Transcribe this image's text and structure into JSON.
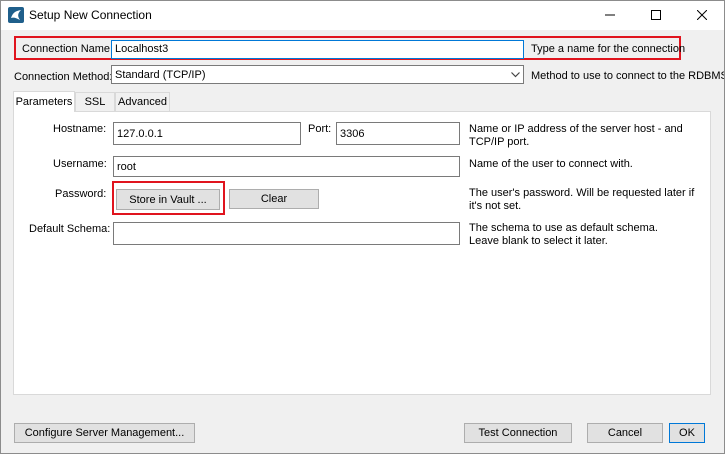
{
  "window": {
    "title": "Setup New Connection",
    "icon": "mysql-workbench-icon",
    "controls": [
      "minimize-icon",
      "maximize-icon",
      "close-icon"
    ]
  },
  "connection_name": {
    "label": "Connection Name:",
    "value": "Localhost3",
    "hint": "Type a name for the connection"
  },
  "connection_method": {
    "label": "Connection Method:",
    "value": "Standard (TCP/IP)",
    "hint": "Method to use to connect to the RDBMS"
  },
  "tabs": [
    {
      "label": "Parameters",
      "active": true
    },
    {
      "label": "SSL",
      "active": false
    },
    {
      "label": "Advanced",
      "active": false
    }
  ],
  "parameters": {
    "hostname": {
      "label": "Hostname:",
      "value": "127.0.0.1"
    },
    "port": {
      "label": "Port:",
      "value": "3306"
    },
    "hostname_hint": "Name or IP address of the server host - and TCP/IP port.",
    "username": {
      "label": "Username:",
      "value": "root",
      "hint": "Name of the user to connect with."
    },
    "password": {
      "label": "Password:",
      "store_button": "Store in Vault ...",
      "clear_button": "Clear",
      "hint": "The user's password. Will be requested later if it's not set."
    },
    "default_schema": {
      "label": "Default Schema:",
      "value": "",
      "hint": "The schema to use as default schema. Leave blank to select it later."
    }
  },
  "footer": {
    "configure_button": "Configure Server Management...",
    "test_button": "Test Connection",
    "cancel_button": "Cancel",
    "ok_button": "OK"
  },
  "colors": {
    "highlight": "#e0141e",
    "background": "#f0f0f0",
    "panel": "#ffffff"
  }
}
